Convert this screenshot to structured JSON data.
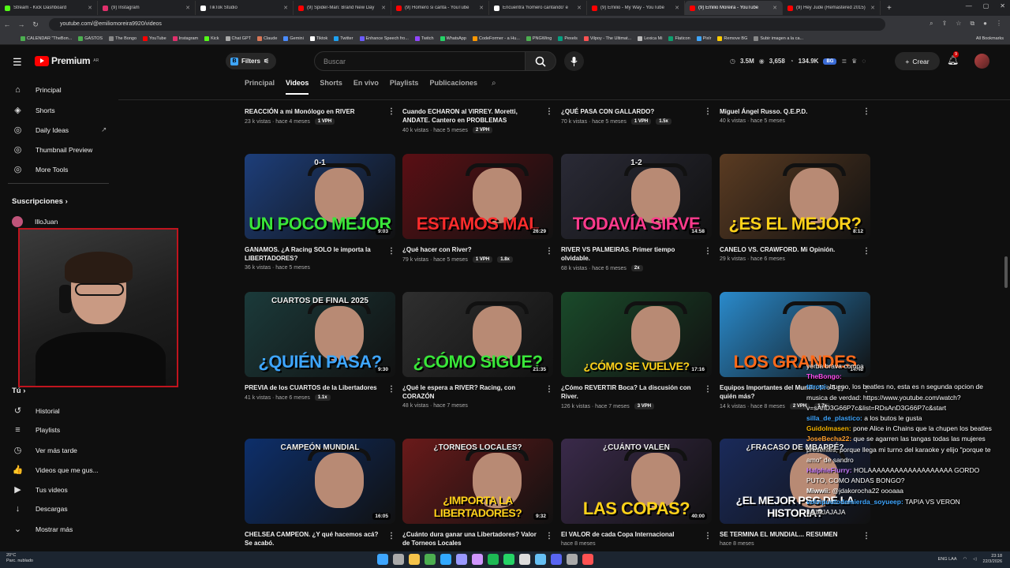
{
  "browser": {
    "tabs": [
      {
        "title": "Stream - Kick Dashboard",
        "color": "#53fc18",
        "active": false
      },
      {
        "title": "(9) Instagram",
        "color": "#e1306c",
        "active": false
      },
      {
        "title": "TikTok Studio",
        "color": "#ffffff",
        "active": false
      },
      {
        "title": "(9) Spider-Man: Brand New Day",
        "color": "#ff0000",
        "active": false
      },
      {
        "title": "(9) Homero si canta - YouTube",
        "color": "#ff0000",
        "active": false
      },
      {
        "title": "Encuentra 'homero cantando' e",
        "color": "#ffffff",
        "active": false
      },
      {
        "title": "(9) Emilio - My Way - YouTube",
        "color": "#ff0000",
        "active": false
      },
      {
        "title": "(9) Emilio Moreira - YouTube",
        "color": "#ff0000",
        "active": true
      },
      {
        "title": "(9) Hey Jude (Remastered 2015)",
        "color": "#ff0000",
        "active": false
      }
    ],
    "new_tab": "+",
    "url": "youtube.com/@emiliomoreira9920/videos",
    "bookmarks": [
      {
        "label": "CALENDAR \"TheBon...",
        "color": "#4caf50"
      },
      {
        "label": "GASTOS",
        "color": "#4caf50"
      },
      {
        "label": "The Bongo",
        "color": "#888888"
      },
      {
        "label": "YouTube",
        "color": "#ff0000"
      },
      {
        "label": "Instagram",
        "color": "#e1306c"
      },
      {
        "label": "Kick",
        "color": "#53fc18"
      },
      {
        "label": "Chat GPT",
        "color": "#aaaaaa"
      },
      {
        "label": "Claude",
        "color": "#d97757"
      },
      {
        "label": "Gemini",
        "color": "#4a8cff"
      },
      {
        "label": "Tiktok",
        "color": "#ffffff"
      },
      {
        "label": "Twitter",
        "color": "#1da1f2"
      },
      {
        "label": "Enhance Speech fro...",
        "color": "#6b5bff"
      },
      {
        "label": "Twitch",
        "color": "#9146ff"
      },
      {
        "label": "WhatsApp",
        "color": "#25d366"
      },
      {
        "label": "CodeFormer - a Hu...",
        "color": "#ff9800"
      },
      {
        "label": "PNGWing",
        "color": "#4caf50"
      },
      {
        "label": "Pexels",
        "color": "#05a081"
      },
      {
        "label": "Vilpoy - The Ultimat...",
        "color": "#ff5252"
      },
      {
        "label": "Lexica Mi",
        "color": "#bbbbbb"
      },
      {
        "label": "Flaticon",
        "color": "#0e9f6e"
      },
      {
        "label": "Pixlr",
        "color": "#3ea6ff"
      },
      {
        "label": "Remove BG",
        "color": "#ffcc00"
      },
      {
        "label": "Subir imagen a la ca...",
        "color": "#888888"
      }
    ],
    "all_bookmarks": "All Bookmarks"
  },
  "header": {
    "logo": "Premium",
    "region": "AR",
    "filters": "Filters",
    "search_placeholder": "Buscar",
    "stats": {
      "subs": "3.5M",
      "views": "3,658",
      "watch": "134.9K",
      "tag": "BG"
    },
    "create": "Crear",
    "notif_count": "9"
  },
  "sidebar": {
    "main": [
      {
        "label": "Principal",
        "icon": "home-icon",
        "glyph": "⌂"
      },
      {
        "label": "Shorts",
        "icon": "shorts-icon",
        "glyph": "◈"
      },
      {
        "label": "Daily Ideas",
        "icon": "bulb-icon",
        "glyph": "◎"
      },
      {
        "label": "Thumbnail Preview",
        "icon": "preview-icon",
        "glyph": "◎"
      },
      {
        "label": "More Tools",
        "icon": "tools-icon",
        "glyph": "◎"
      }
    ],
    "subs_title": "Suscripciones",
    "subs": [
      {
        "label": "IlloJuan"
      }
    ],
    "you_title": "Tú",
    "you": [
      {
        "label": "Historial",
        "icon": "history-icon",
        "glyph": "↺"
      },
      {
        "label": "Playlists",
        "icon": "playlist-icon",
        "glyph": "≡"
      },
      {
        "label": "Ver más tarde",
        "icon": "clock-icon",
        "glyph": "◷"
      },
      {
        "label": "Videos que me gus...",
        "icon": "thumbs-up-icon",
        "glyph": "👍"
      },
      {
        "label": "Tus videos",
        "icon": "video-icon",
        "glyph": "▶"
      },
      {
        "label": "Descargas",
        "icon": "download-icon",
        "glyph": "↓"
      },
      {
        "label": "Mostrar más",
        "icon": "chevron-down-icon",
        "glyph": "⌄"
      }
    ]
  },
  "channel_tabs": [
    {
      "label": "Principal",
      "active": false
    },
    {
      "label": "Videos",
      "active": true
    },
    {
      "label": "Shorts",
      "active": false
    },
    {
      "label": "En vivo",
      "active": false
    },
    {
      "label": "Playlists",
      "active": false
    },
    {
      "label": "Publicaciones",
      "active": false
    }
  ],
  "videos_top": [
    {
      "title": "REACCIÓN a mi Monólogo en RIVER",
      "meta": "23 k vistas · hace 4 meses",
      "badges": [
        "1 VPH"
      ]
    },
    {
      "title": "Cuando ECHARON al VIRREY. Moretti, ANDATE. Cantero en PROBLEMAS",
      "meta": "40 k vistas · hace 5 meses",
      "badges": [
        "2 VPH"
      ]
    },
    {
      "title": "¿QUÉ PASA CON GALLARDO?",
      "meta": "70 k vistas · hace 5 meses",
      "badges": [
        "1 VPH",
        "1.5x"
      ]
    },
    {
      "title": "Miguel Ángel Russo. Q.E.P.D.",
      "meta": "40 k vistas · hace 5 meses",
      "badges": []
    }
  ],
  "videos": [
    {
      "title": "GANAMOS. ¿A Racing SOLO le importa la LIBERTADORES?",
      "meta": "36 k vistas · hace 5 meses",
      "badges": [],
      "dur": "9:03",
      "big": "UN POCO MEJOR",
      "top": "0-1",
      "color": "#39e639",
      "bg": "#1d3e7a"
    },
    {
      "title": "¿Qué hacer con River?",
      "meta": "79 k vistas · hace 5 meses",
      "badges": [
        "1 VPH",
        "1.8x"
      ],
      "dur": "26:29",
      "big": "ESTAMOS MAL",
      "top": "",
      "color": "#ff2c2c",
      "bg": "#5a0f14"
    },
    {
      "title": "RIVER VS PALMEIRAS. Primer tiempo olvidable.",
      "meta": "68 k vistas · hace 6 meses",
      "badges": [
        "2x"
      ],
      "dur": "14:58",
      "big": "TODAVÍA SIRVE",
      "top": "1-2",
      "color": "#ff3a8c",
      "bg": "#2a2a36"
    },
    {
      "title": "CANELO VS. CRAWFORD. Mi Opinión.",
      "meta": "29 k vistas · hace 6 meses",
      "badges": [],
      "dur": "8:12",
      "big": "¿ES EL MEJOR?",
      "top": "",
      "color": "#ffd21a",
      "bg": "#5a3b22"
    },
    {
      "title": "PREVIA de los CUARTOS de la Libertadores",
      "meta": "41 k vistas · hace 6 meses",
      "badges": [
        "1.1x"
      ],
      "dur": "9:30",
      "big": "¿QUIÉN PASA?",
      "top": "CUARTOS DE FINAL 2025",
      "color": "#3ea6ff",
      "bg": "#1b3a3a"
    },
    {
      "title": "¿Qué le espera a RIVER? Racing, con CORAZÓN",
      "meta": "48 k vistas · hace 7 meses",
      "badges": [],
      "dur": "21:35",
      "big": "¿CÓMO SIGUE?",
      "top": "",
      "color": "#39e639",
      "bg": "#2f2f2f"
    },
    {
      "title": "¿Cómo REVERTIR Boca? La discusión con River.",
      "meta": "126 k vistas · hace 7 meses",
      "badges": [
        "3 VPH"
      ],
      "dur": "17:16",
      "big": "¿CÓMO SE VUELVE?",
      "top": "",
      "color": "#ffd21a",
      "bg": "#1a4a2a"
    },
    {
      "title": "Equipos Importantes del Mundo. Nro 5 ¿y quién más?",
      "meta": "14 k vistas · hace 8 meses",
      "badges": [
        "2 VPH",
        "1.7x"
      ],
      "dur": "14:48",
      "big": "LOS GRANDES",
      "top": "",
      "color": "#ff6a1a",
      "bg": "#2a8acb"
    },
    {
      "title": "CHELSEA CAMPEON. ¿Y qué hacemos acá? Se acabó.",
      "meta": "",
      "badges": [],
      "dur": "16:05",
      "big": "",
      "top": "CAMPEÓN MUNDIAL",
      "color": "#ffd21a",
      "bg": "#0d2f6b"
    },
    {
      "title": "¿Cuánto dura ganar una Libertadores? Valor de Torneos Locales",
      "meta": "",
      "badges": [],
      "dur": "9:32",
      "big": "¿IMPORTA LA LIBERTADORES?",
      "top": "¿TORNEOS LOCALES?",
      "color": "#ffd21a",
      "bg": "#6a1a1a"
    },
    {
      "title": "El VALOR de cada Copa Internacional",
      "meta": "hace 8 meses",
      "badges": [],
      "dur": "40:00",
      "big": "LAS COPAS?",
      "top": "¿CUÁNTO VALEN",
      "color": "#ffd21a",
      "bg": "#3a2a4a"
    },
    {
      "title": "SE TERMINA EL MUNDIAL... RESUMEN",
      "meta": "hace 8 meses",
      "badges": [],
      "dur": "",
      "big": "¿EL MEJOR PSG DE LA HISTORIA?",
      "top": "¿FRACASO DE MBAPPÉ?",
      "color": "#ffffff",
      "bg": "#1a2a5a"
    }
  ],
  "chat": [
    {
      "user": "",
      "text": "yerba brava compa",
      "color": "#ffffff"
    },
    {
      "user": "TheBongo:",
      "text": "",
      "color": "#ff4df0"
    },
    {
      "user": "tttropi:",
      "text": "bueno, los beatles no, esta es n segunda opcion de musica de verdad: https://www.youtube.com/watch?v=sAnD3G66P7c&list=RDsAnD3G66P7c&start",
      "color": "#3ea6ff"
    },
    {
      "user": "silla_de_plastico:",
      "text": "a los butos le gusta",
      "color": "#3ea6ff"
    },
    {
      "user": "Guidolmasen:",
      "text": "pone Alice in Chains que la chupen los beatles",
      "color": "#f5b400"
    },
    {
      "user": "JoseBecha22:",
      "text": "que se agarren las tangas todas las mujeres presentes, porque llega mi turno del karaoke y elijo \"porque te amo\" de sandro",
      "color": "#ff9e2c"
    },
    {
      "user": "HalphieFlurry:",
      "text": "HOLAAAAAAAAAAAAAAAAAAA GORDO PUTO, COMO ANDAS BONGO?",
      "color": "#c77dff"
    },
    {
      "user": "Miwwii:",
      "text": "@jdakorocha22 oooaaa",
      "color": "#ffffff"
    },
    {
      "user": "volvipuutodemierda_soyueep:",
      "text": "TAPIA VS VERON JAJAJAJAJA",
      "color": "#3ea6ff"
    }
  ],
  "taskbar": {
    "temp": "20°C",
    "weather": "Parc. nublado",
    "lang": "ENG LAA",
    "time": "23:18",
    "date": "22/3/2026"
  }
}
